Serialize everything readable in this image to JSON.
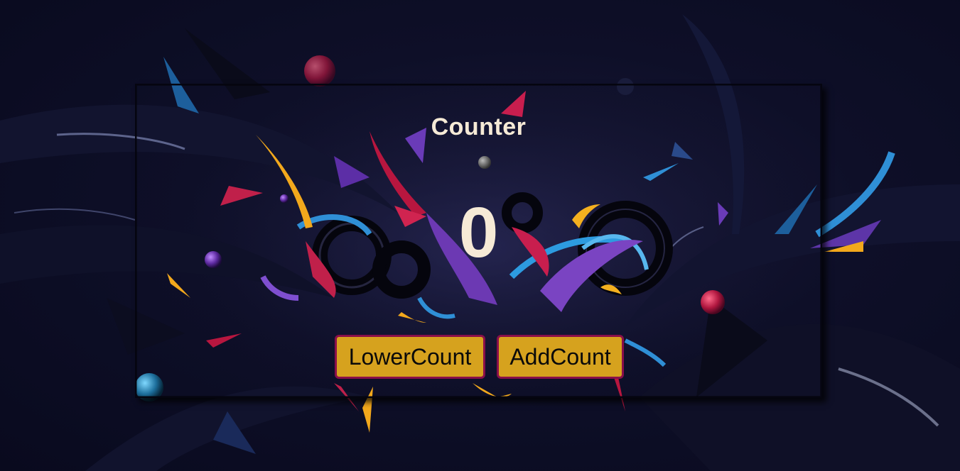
{
  "app": {
    "title": "Counter",
    "count": "0"
  },
  "buttons": {
    "lower_label": "LowerCount",
    "add_label": "AddCount"
  },
  "colors": {
    "background": "#0b0c22",
    "text": "#f6ead6",
    "button_fill": "#d6a21e",
    "button_border": "#8a0f4a"
  }
}
